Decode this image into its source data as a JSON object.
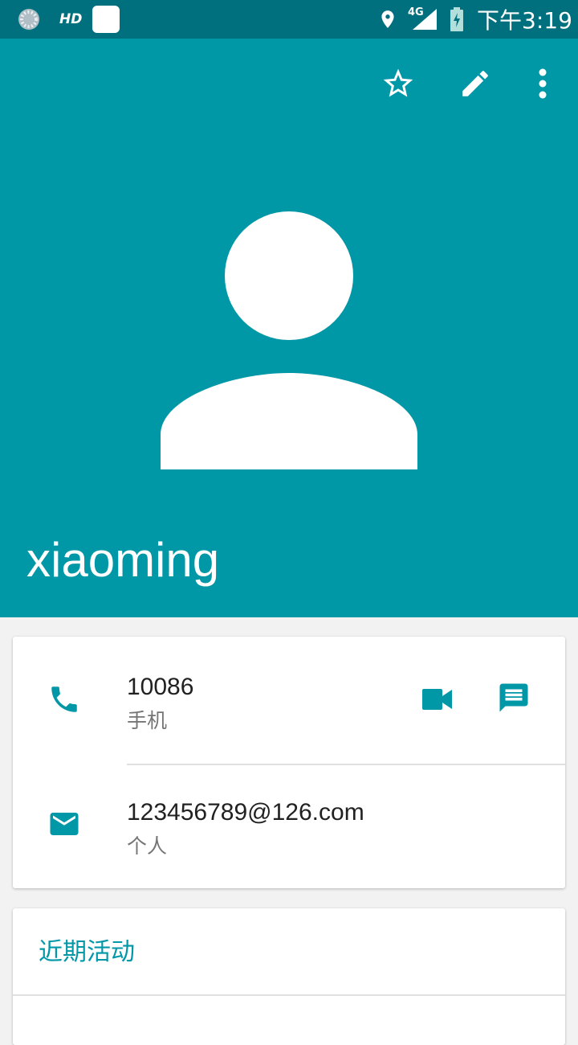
{
  "status_bar": {
    "hd_label": "HD",
    "network_label": "4G",
    "time": "下午3:19"
  },
  "toolbar": {
    "favorite_icon": "star-outline-icon",
    "edit_icon": "pencil-icon",
    "more_icon": "more-vert-icon"
  },
  "contact": {
    "name": "xiaoming",
    "avatar_icon": "person-placeholder-icon"
  },
  "details": {
    "phone": {
      "number": "10086",
      "type": "手机"
    },
    "email": {
      "address": "123456789@126.com",
      "type": "个人"
    }
  },
  "recent_activity": {
    "title": "近期活动"
  },
  "colors": {
    "status_bar": "#00707e",
    "header": "#0097a7",
    "accent": "#0097a7",
    "background": "#f2f2f2"
  }
}
